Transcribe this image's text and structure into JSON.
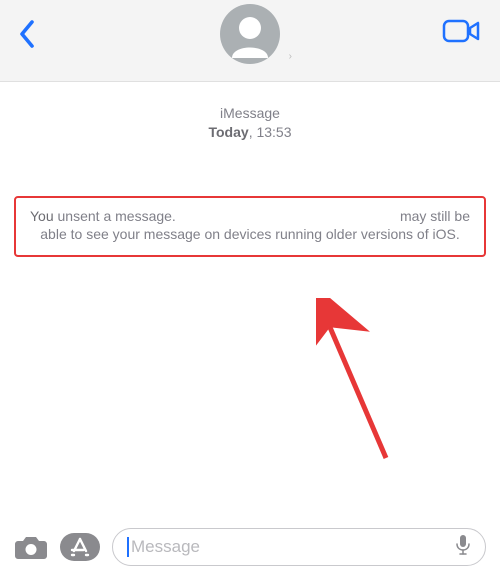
{
  "header": {
    "back_label": "Back",
    "video_label": "Video Call"
  },
  "stamp": {
    "label": "iMessage",
    "day": "Today",
    "time": "13:53"
  },
  "notice": {
    "prefix": "You",
    "top_left": " unsent a message.",
    "top_right": "may still be",
    "rest": "able to see your message on devices running older versions of iOS."
  },
  "input": {
    "placeholder": "Message"
  },
  "colors": {
    "accent": "#1f71ff",
    "highlight_border": "#e73737"
  }
}
